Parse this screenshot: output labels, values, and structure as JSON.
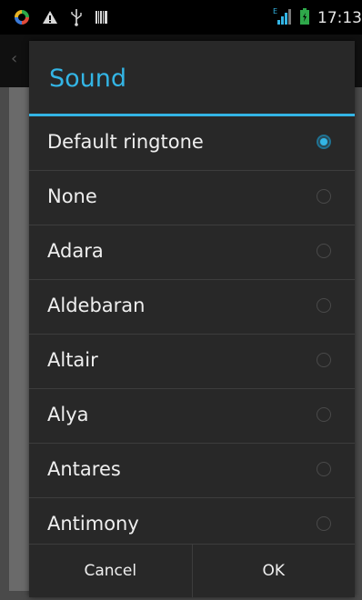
{
  "status_bar": {
    "time": "17:13",
    "icons_left": [
      "sync-icon",
      "warning-icon",
      "usb-icon",
      "barcode-icon"
    ],
    "icons_right": [
      "signal-icon",
      "battery-icon"
    ],
    "signal_type": "E"
  },
  "dialog": {
    "title": "Sound",
    "items": [
      {
        "label": "Default ringtone",
        "selected": true
      },
      {
        "label": "None",
        "selected": false
      },
      {
        "label": "Adara",
        "selected": false
      },
      {
        "label": "Aldebaran",
        "selected": false
      },
      {
        "label": "Altair",
        "selected": false
      },
      {
        "label": "Alya",
        "selected": false
      },
      {
        "label": "Antares",
        "selected": false
      },
      {
        "label": "Antimony",
        "selected": false
      }
    ],
    "cancel_label": "Cancel",
    "ok_label": "OK"
  },
  "colors": {
    "accent": "#33b5e5",
    "dialog_bg": "#282828",
    "text": "#efefef"
  }
}
